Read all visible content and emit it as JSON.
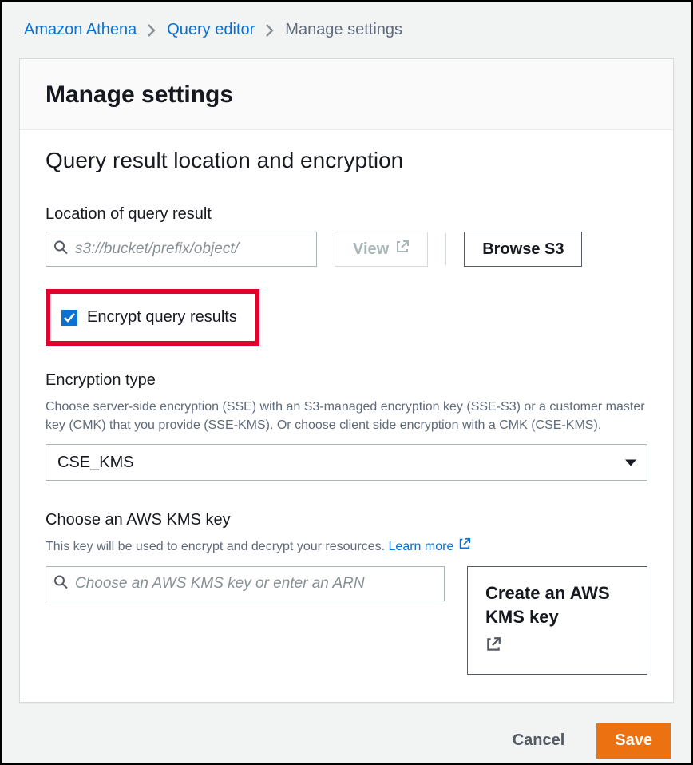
{
  "breadcrumb": {
    "items": [
      {
        "label": "Amazon Athena"
      },
      {
        "label": "Query editor"
      }
    ],
    "current": "Manage settings"
  },
  "header": {
    "title": "Manage settings"
  },
  "section": {
    "title": "Query result location and encryption",
    "location": {
      "label": "Location of query result",
      "placeholder": "s3://bucket/prefix/object/",
      "view_label": "View",
      "browse_label": "Browse S3"
    },
    "encrypt_checkbox": {
      "label": "Encrypt query results",
      "checked": true
    },
    "encryption_type": {
      "label": "Encryption type",
      "description": "Choose server-side encryption (SSE) with an S3-managed encryption key (SSE-S3) or a customer master key (CMK) that you provide (SSE-KMS). Or choose client side encryption with a CMK (CSE-KMS).",
      "value": "CSE_KMS"
    },
    "kms": {
      "label": "Choose an AWS KMS key",
      "description_prefix": "This key will be used to encrypt and decrypt your resources. ",
      "learn_more": "Learn more",
      "placeholder": "Choose an AWS KMS key or enter an ARN",
      "create_label": "Create an AWS KMS key"
    }
  },
  "actions": {
    "cancel": "Cancel",
    "save": "Save"
  }
}
